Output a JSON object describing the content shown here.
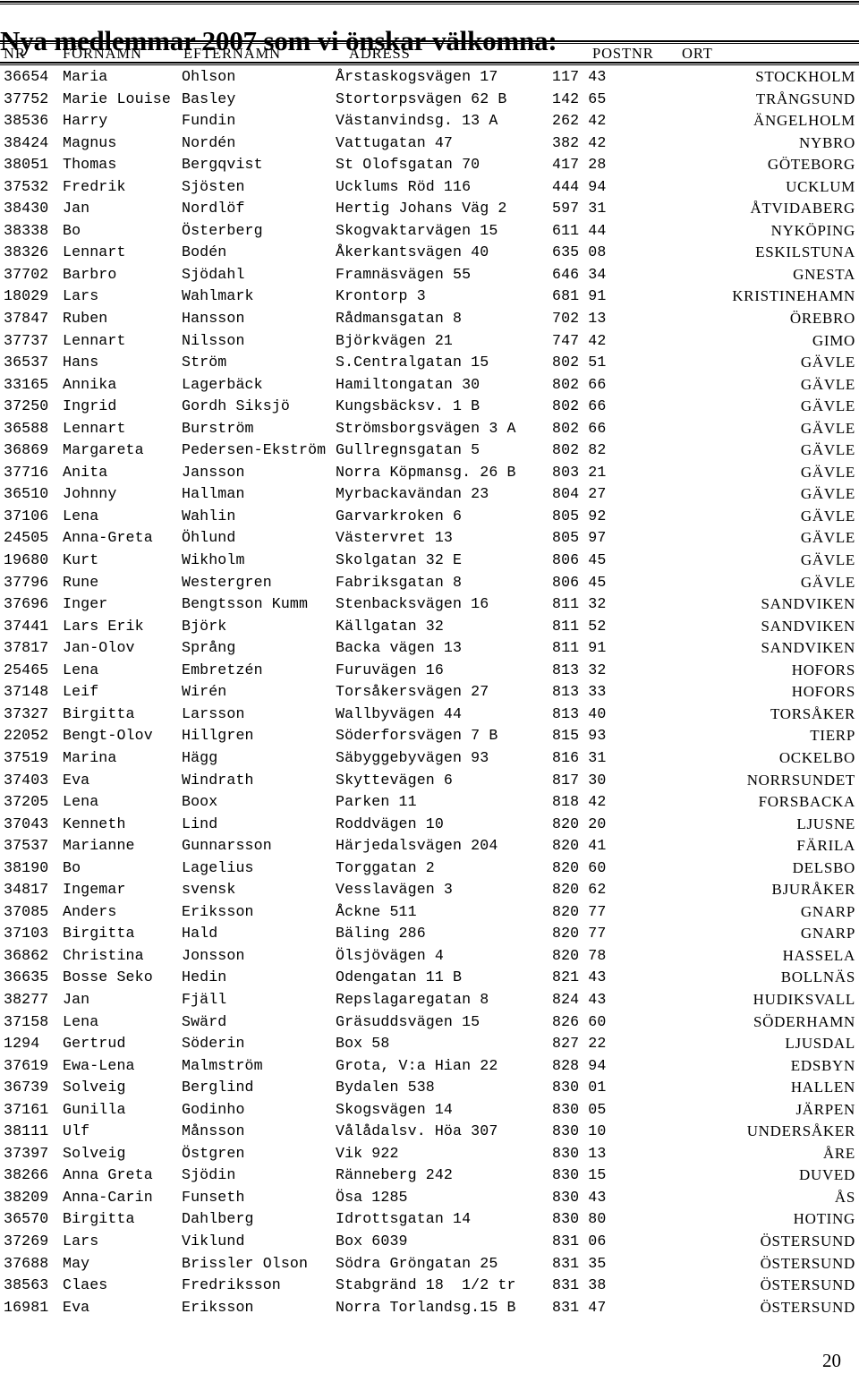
{
  "document": {
    "title": "Nya medlemmar 2007 som vi önskar välkomna:",
    "page_number": "20"
  },
  "table": {
    "columns": [
      "NR",
      "FÖRNAMN",
      "EFTERNAMN",
      "ADRESS",
      "POSTNR",
      "ORT"
    ],
    "rows": [
      {
        "nr": "36654",
        "fornamn": "Maria",
        "efternamn": "Ohlson",
        "adress": "Årstaskogsvägen 17",
        "postnr": "117 43",
        "ort": "STOCKHOLM"
      },
      {
        "nr": "37752",
        "fornamn": "Marie Louise",
        "efternamn": "Basley",
        "adress": "Stortorpsvägen 62 B",
        "postnr": "142 65",
        "ort": "TRÅNGSUND"
      },
      {
        "nr": "38536",
        "fornamn": "Harry",
        "efternamn": "Fundin",
        "adress": "Västanvindsg. 13 A",
        "postnr": "262 42",
        "ort": "ÄNGELHOLM"
      },
      {
        "nr": "38424",
        "fornamn": "Magnus",
        "efternamn": "Nordén",
        "adress": "Vattugatan 47",
        "postnr": "382 42",
        "ort": "NYBRO"
      },
      {
        "nr": "38051",
        "fornamn": "Thomas",
        "efternamn": "Bergqvist",
        "adress": "St Olofsgatan 70",
        "postnr": "417 28",
        "ort": "GÖTEBORG"
      },
      {
        "nr": "37532",
        "fornamn": "Fredrik",
        "efternamn": "Sjösten",
        "adress": "Ucklums Röd 116",
        "postnr": "444 94",
        "ort": "UCKLUM"
      },
      {
        "nr": "38430",
        "fornamn": "Jan",
        "efternamn": "Nordlöf",
        "adress": "Hertig Johans Väg 2",
        "postnr": "597 31",
        "ort": "ÅTVIDABERG"
      },
      {
        "nr": "38338",
        "fornamn": "Bo",
        "efternamn": "Österberg",
        "adress": "Skogvaktarvägen 15",
        "postnr": "611 44",
        "ort": "NYKÖPING"
      },
      {
        "nr": "38326",
        "fornamn": "Lennart",
        "efternamn": "Bodén",
        "adress": "Åkerkantsvägen 40",
        "postnr": "635 08",
        "ort": "ESKILSTUNA"
      },
      {
        "nr": "37702",
        "fornamn": "Barbro",
        "efternamn": "Sjödahl",
        "adress": "Framnäsvägen 55",
        "postnr": "646 34",
        "ort": "GNESTA"
      },
      {
        "nr": "18029",
        "fornamn": "Lars",
        "efternamn": "Wahlmark",
        "adress": "Krontorp 3",
        "postnr": "681 91",
        "ort": "KRISTINEHAMN"
      },
      {
        "nr": "37847",
        "fornamn": "Ruben",
        "efternamn": "Hansson",
        "adress": "Rådmansgatan 8",
        "postnr": "702 13",
        "ort": "ÖREBRO"
      },
      {
        "nr": "37737",
        "fornamn": "Lennart",
        "efternamn": "Nilsson",
        "adress": "Björkvägen 21",
        "postnr": "747 42",
        "ort": "GIMO"
      },
      {
        "nr": "36537",
        "fornamn": "Hans",
        "efternamn": "Ström",
        "adress": "S.Centralgatan 15",
        "postnr": "802 51",
        "ort": "GÄVLE"
      },
      {
        "nr": "33165",
        "fornamn": "Annika",
        "efternamn": "Lagerbäck",
        "adress": "Hamiltongatan 30",
        "postnr": "802 66",
        "ort": "GÄVLE"
      },
      {
        "nr": "37250",
        "fornamn": "Ingrid",
        "efternamn": "Gordh Siksjö",
        "adress": "Kungsbäcksv. 1 B",
        "postnr": "802 66",
        "ort": "GÄVLE"
      },
      {
        "nr": "36588",
        "fornamn": "Lennart",
        "efternamn": "Burström",
        "adress": "Strömsborgsvägen 3 A",
        "postnr": "802 66",
        "ort": "GÄVLE"
      },
      {
        "nr": "36869",
        "fornamn": "Margareta",
        "efternamn": "Pedersen-Ekström",
        "adress": "Gullregnsgatan 5",
        "postnr": "802 82",
        "ort": "GÄVLE"
      },
      {
        "nr": "37716",
        "fornamn": "Anita",
        "efternamn": "Jansson",
        "adress": "Norra Köpmansg. 26 B",
        "postnr": "803 21",
        "ort": "GÄVLE"
      },
      {
        "nr": "36510",
        "fornamn": "Johnny",
        "efternamn": "Hallman",
        "adress": "Myrbackavändan 23",
        "postnr": "804 27",
        "ort": "GÄVLE"
      },
      {
        "nr": "37106",
        "fornamn": "Lena",
        "efternamn": "Wahlin",
        "adress": "Garvarkroken 6",
        "postnr": "805 92",
        "ort": "GÄVLE"
      },
      {
        "nr": "24505",
        "fornamn": "Anna-Greta",
        "efternamn": "Öhlund",
        "adress": "Västervret 13",
        "postnr": "805 97",
        "ort": "GÄVLE"
      },
      {
        "nr": "19680",
        "fornamn": "Kurt",
        "efternamn": "Wikholm",
        "adress": "Skolgatan 32 E",
        "postnr": "806 45",
        "ort": "GÄVLE"
      },
      {
        "nr": "37796",
        "fornamn": "Rune",
        "efternamn": "Westergren",
        "adress": "Fabriksgatan 8",
        "postnr": "806 45",
        "ort": "GÄVLE"
      },
      {
        "nr": "37696",
        "fornamn": "Inger",
        "efternamn": "Bengtsson Kumm",
        "adress": "Stenbacksvägen 16",
        "postnr": "811 32",
        "ort": "SANDVIKEN"
      },
      {
        "nr": "37441",
        "fornamn": "Lars Erik",
        "efternamn": "Björk",
        "adress": "Källgatan 32",
        "postnr": "811 52",
        "ort": "SANDVIKEN"
      },
      {
        "nr": "37817",
        "fornamn": "Jan-Olov",
        "efternamn": "Språng",
        "adress": "Backa vägen 13",
        "postnr": "811 91",
        "ort": "SANDVIKEN"
      },
      {
        "nr": "25465",
        "fornamn": "Lena",
        "efternamn": "Embretzén",
        "adress": "Furuvägen 16",
        "postnr": "813 32",
        "ort": "HOFORS"
      },
      {
        "nr": "37148",
        "fornamn": "Leif",
        "efternamn": "Wirén",
        "adress": "Torsåkersvägen 27",
        "postnr": "813 33",
        "ort": "HOFORS"
      },
      {
        "nr": "37327",
        "fornamn": "Birgitta",
        "efternamn": "Larsson",
        "adress": "Wallbyvägen 44",
        "postnr": "813 40",
        "ort": "TORSÅKER"
      },
      {
        "nr": "22052",
        "fornamn": "Bengt-Olov",
        "efternamn": "Hillgren",
        "adress": "Söderforsvägen 7 B",
        "postnr": "815 93",
        "ort": "TIERP"
      },
      {
        "nr": "37519",
        "fornamn": "Marina",
        "efternamn": "Hägg",
        "adress": "Säbyggebyvägen 93",
        "postnr": "816 31",
        "ort": "OCKELBO"
      },
      {
        "nr": "37403",
        "fornamn": "Eva",
        "efternamn": "Windrath",
        "adress": "Skyttevägen 6",
        "postnr": "817 30",
        "ort": "NORRSUNDET"
      },
      {
        "nr": "37205",
        "fornamn": "Lena",
        "efternamn": "Boox",
        "adress": "Parken 11",
        "postnr": "818 42",
        "ort": "FORSBACKA"
      },
      {
        "nr": "37043",
        "fornamn": "Kenneth",
        "efternamn": "Lind",
        "adress": "Roddvägen 10",
        "postnr": "820 20",
        "ort": "LJUSNE"
      },
      {
        "nr": "37537",
        "fornamn": "Marianne",
        "efternamn": "Gunnarsson",
        "adress": "Härjedalsvägen 204",
        "postnr": "820 41",
        "ort": "FÄRILA"
      },
      {
        "nr": "38190",
        "fornamn": "Bo",
        "efternamn": "Lagelius",
        "adress": "Torggatan 2",
        "postnr": "820 60",
        "ort": "DELSBO"
      },
      {
        "nr": "34817",
        "fornamn": "Ingemar",
        "efternamn": "svensk",
        "adress": "Vesslavägen 3",
        "postnr": "820 62",
        "ort": "BJURÅKER"
      },
      {
        "nr": "37085",
        "fornamn": "Anders",
        "efternamn": "Eriksson",
        "adress": "Åckne 511",
        "postnr": "820 77",
        "ort": "GNARP"
      },
      {
        "nr": "37103",
        "fornamn": "Birgitta",
        "efternamn": "Hald",
        "adress": "Bäling 286",
        "postnr": "820 77",
        "ort": "GNARP"
      },
      {
        "nr": "36862",
        "fornamn": "Christina",
        "efternamn": "Jonsson",
        "adress": "Ölsjövägen 4",
        "postnr": "820 78",
        "ort": "HASSELA"
      },
      {
        "nr": "36635",
        "fornamn": "Bosse Seko",
        "efternamn": "Hedin",
        "adress": "Odengatan 11 B",
        "postnr": "821 43",
        "ort": "BOLLNÄS"
      },
      {
        "nr": "38277",
        "fornamn": "Jan",
        "efternamn": "Fjäll",
        "adress": "Repslagaregatan 8",
        "postnr": "824 43",
        "ort": "HUDIKSVALL"
      },
      {
        "nr": "37158",
        "fornamn": "Lena",
        "efternamn": "Swärd",
        "adress": "Gräsuddsvägen 15",
        "postnr": "826 60",
        "ort": "SÖDERHAMN"
      },
      {
        "nr": "1294 ",
        "fornamn": "Gertrud",
        "efternamn": "Söderin",
        "adress": "Box 58",
        "postnr": "827 22",
        "ort": "LJUSDAL"
      },
      {
        "nr": "37619",
        "fornamn": "Ewa-Lena",
        "efternamn": "Malmström",
        "adress": "Grota, V:a Hian 22",
        "postnr": "828 94",
        "ort": "EDSBYN"
      },
      {
        "nr": "36739",
        "fornamn": "Solveig",
        "efternamn": "Berglind",
        "adress": "Bydalen 538",
        "postnr": "830 01",
        "ort": "HALLEN"
      },
      {
        "nr": "37161",
        "fornamn": "Gunilla",
        "efternamn": "Godinho",
        "adress": "Skogsvägen 14",
        "postnr": "830 05",
        "ort": "JÄRPEN"
      },
      {
        "nr": "38111",
        "fornamn": "Ulf",
        "efternamn": "Månsson",
        "adress": "Vålådalsv. Höa 307",
        "postnr": "830 10",
        "ort": "UNDERSÅKER"
      },
      {
        "nr": "37397",
        "fornamn": "Solveig",
        "efternamn": "Östgren",
        "adress": "Vik 922",
        "postnr": "830 13",
        "ort": "ÅRE"
      },
      {
        "nr": "38266",
        "fornamn": "Anna Greta",
        "efternamn": "Sjödin",
        "adress": "Ränneberg 242",
        "postnr": "830 15",
        "ort": "DUVED"
      },
      {
        "nr": "38209",
        "fornamn": "Anna-Carin",
        "efternamn": "Funseth",
        "adress": "Ösa 1285",
        "postnr": "830 43",
        "ort": "ÅS"
      },
      {
        "nr": "36570",
        "fornamn": "Birgitta",
        "efternamn": "Dahlberg",
        "adress": "Idrottsgatan 14",
        "postnr": "830 80",
        "ort": "HOTING"
      },
      {
        "nr": "37269",
        "fornamn": "Lars",
        "efternamn": "Viklund",
        "adress": "Box 6039",
        "postnr": "831 06",
        "ort": "ÖSTERSUND"
      },
      {
        "nr": "37688",
        "fornamn": "May",
        "efternamn": "Brissler Olson",
        "adress": "Södra Gröngatan 25",
        "postnr": "831 35",
        "ort": "ÖSTERSUND"
      },
      {
        "nr": "38563",
        "fornamn": "Claes",
        "efternamn": "Fredriksson",
        "adress": "Stabgränd 18  1/2 tr",
        "postnr": "831 38",
        "ort": "ÖSTERSUND"
      },
      {
        "nr": "16981",
        "fornamn": "Eva",
        "efternamn": "Eriksson",
        "adress": "Norra Torlandsg.15 B",
        "postnr": "831 47",
        "ort": "ÖSTERSUND"
      }
    ]
  }
}
